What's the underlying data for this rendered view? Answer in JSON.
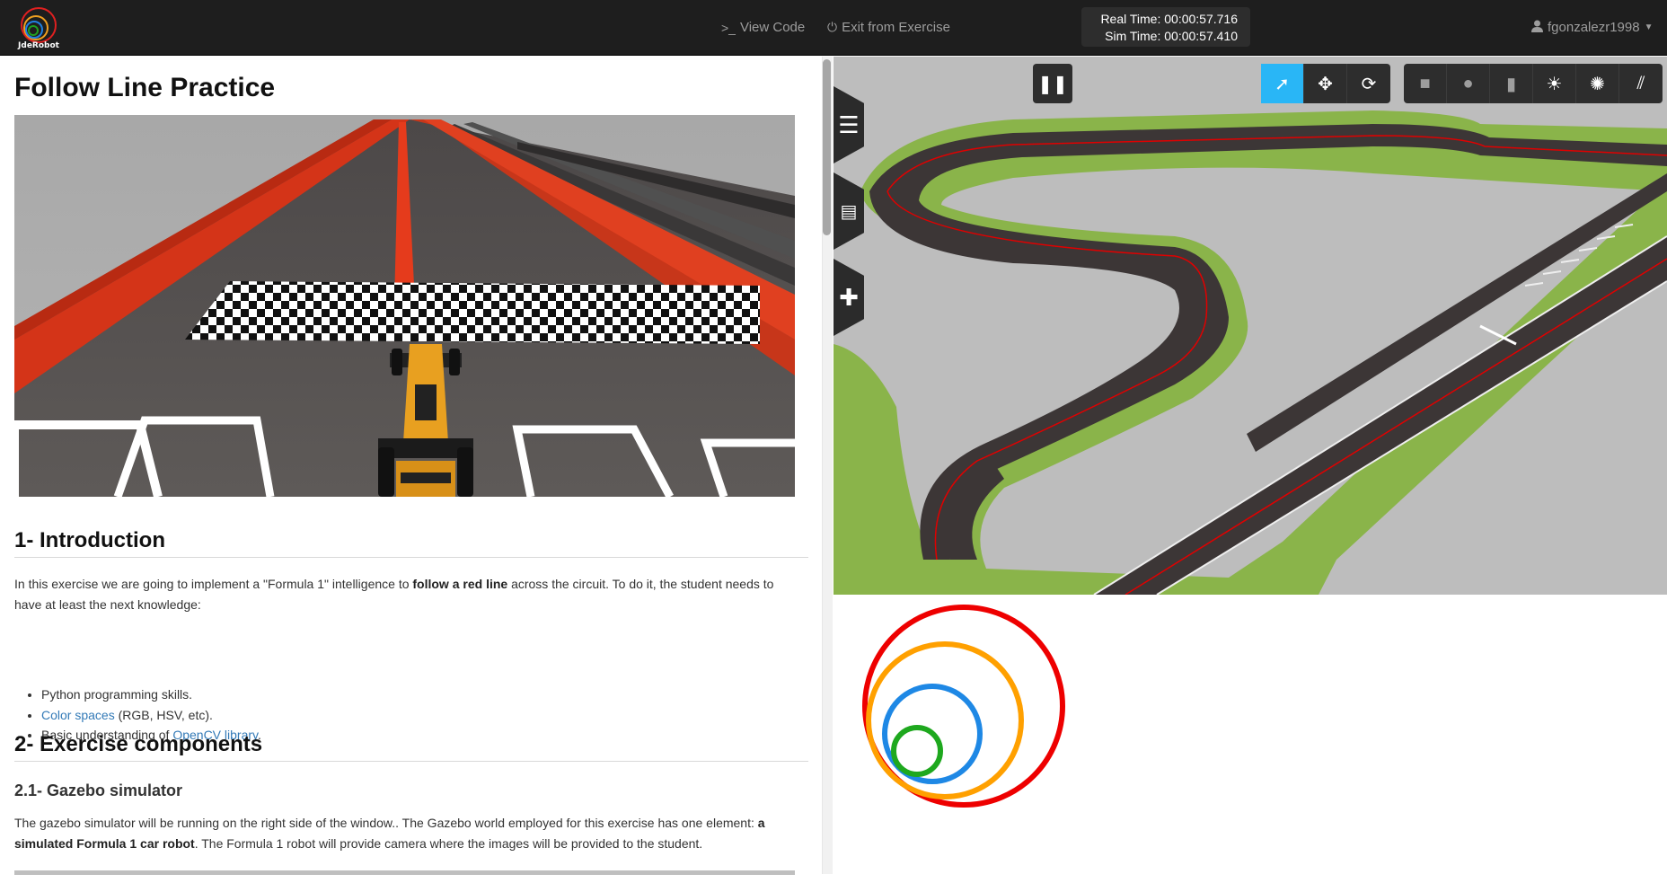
{
  "navbar": {
    "logo_text": "JdeRobot",
    "view_code": "View Code",
    "exit_exercise": "Exit from Exercise",
    "username": "fgonzalezr1998"
  },
  "doc": {
    "title": "Follow Line Practice",
    "intro_heading": "1- Introduction",
    "intro_p1_a": "In this exercise we are going to implement a \"Formula 1\" intelligence to ",
    "intro_p1_b": "follow a red line",
    "intro_p1_c": " across the circuit. To do it, the student needs to have at least the next knowledge:",
    "list": {
      "item1": "Python programming skills.",
      "item2_link": "Color spaces",
      "item2_rest": " (RGB, HSV, etc).",
      "item3_pre": "Basic understanding of ",
      "item3_link": "OpenCV library",
      "item3_post": "."
    },
    "components_heading": "2- Exercise components",
    "gazebo_heading": "2.1- Gazebo simulator",
    "gazebo_p_a": "The gazebo simulator will be running on the right side of the window.. The Gazebo world employed for this exercise has one element: ",
    "gazebo_p_b": "a simulated Formula 1 car robot",
    "gazebo_p_c": ". The Formula 1 robot will provide camera where the images will be provided to the student."
  },
  "gazebo": {
    "real_time_label": "Real Time:",
    "real_time": "00:00:57.716",
    "sim_time_label": "Sim Time:",
    "sim_time": "00:00:57.410"
  },
  "colors": {
    "navbar": "#1e1e1e",
    "accent": "#29b6f6",
    "link": "#337ab7",
    "track_red": "#e60000",
    "grass": "#8db44a"
  },
  "icons": [
    "view-code-icon",
    "power-icon",
    "user-icon",
    "pause-icon",
    "select-icon",
    "translate-icon",
    "rotate-icon",
    "box-icon",
    "sphere-icon",
    "cylinder-icon",
    "point-light-icon",
    "spot-light-icon",
    "directional-light-icon",
    "menu-icon",
    "layers-icon",
    "plus-icon"
  ]
}
